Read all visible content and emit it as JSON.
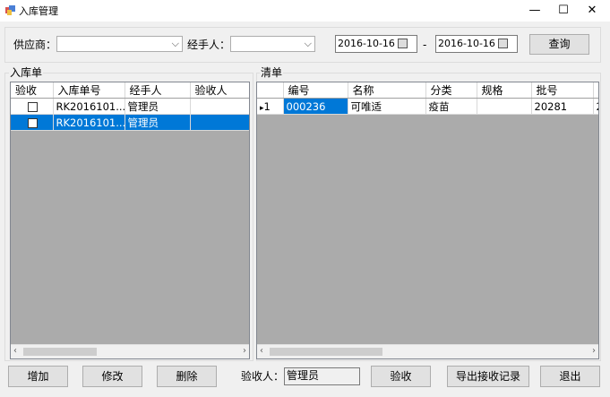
{
  "window": {
    "title": "入库管理",
    "minimize": "—",
    "maximize": "☐",
    "close": "✕"
  },
  "filter": {
    "supplier_label": "供应商：",
    "supplier_value": "",
    "handler_label": "经手人：",
    "handler_value": "",
    "date_from": "2016-10-16",
    "date_sep": "-",
    "date_to": "2016-10-16",
    "query_button": "查询"
  },
  "inbound": {
    "group_title": "入库单",
    "columns": [
      "验收",
      "入库单号",
      "经手人",
      "验收人"
    ],
    "rows": [
      {
        "checked": false,
        "number": "RK2016101...",
        "handler": "管理员",
        "receiver": ""
      },
      {
        "checked": false,
        "number": "RK2016101...",
        "handler": "管理员",
        "receiver": ""
      }
    ]
  },
  "detail": {
    "group_title": "清单",
    "columns": [
      "编号",
      "名称",
      "分类",
      "规格",
      "批号",
      ""
    ],
    "rows": [
      {
        "row_header": "1",
        "code": "000236",
        "name": "可唯适",
        "category": "疫苗",
        "spec": "",
        "batch": "20281",
        "extra": "2"
      }
    ]
  },
  "footer": {
    "add_button": "增加",
    "edit_button": "修改",
    "delete_button": "删除",
    "receiver_label": "验收人：",
    "receiver_value": "管理员",
    "accept_button": "验收",
    "export_button": "导出接收记录",
    "exit_button": "退出"
  },
  "icons": {
    "scroll_left": "‹",
    "scroll_right": "›",
    "row_pointer": "▸",
    "dropdown": "⌵"
  }
}
